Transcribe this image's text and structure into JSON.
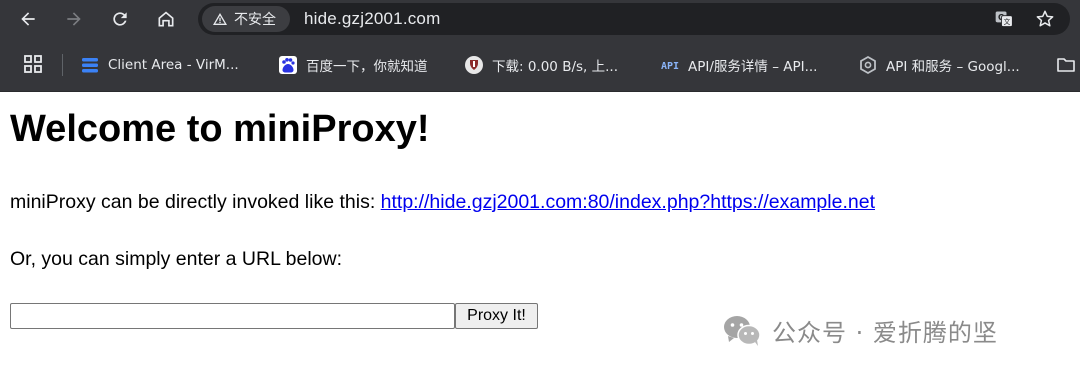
{
  "browser": {
    "security_label": "不安全",
    "url": "hide.gzj2001.com",
    "nav_icons": [
      "back-arrow-icon",
      "forward-arrow-icon",
      "reload-icon",
      "home-icon"
    ],
    "omnibox_icons": [
      "translate-icon",
      "star-icon"
    ]
  },
  "bookmarks": {
    "items": [
      {
        "label": "Client Area - VirM...",
        "icon": "stack-icon",
        "color": "#3b82f6"
      },
      {
        "label": "百度一下，你就知道",
        "icon": "paw-icon",
        "color": "#2932e1"
      },
      {
        "label": "下载: 0.00 B/s, 上...",
        "icon": "download-client-icon",
        "color": "#c9c9c9"
      },
      {
        "label": "API/服务详情 – API...",
        "icon": "api-icon",
        "color": "#8ab4f8"
      },
      {
        "label": "API 和服务 – Googl...",
        "icon": "hexagon-icon",
        "color": "#bdc1c6"
      }
    ]
  },
  "page": {
    "heading": "Welcome to miniProxy!",
    "intro_text": "miniProxy can be directly invoked like this: ",
    "example_link": "http://hide.gzj2001.com:80/index.php?https://example.net",
    "or_text": "Or, you can simply enter a URL below:",
    "input_value": "",
    "submit_label": "Proxy It!"
  },
  "watermark": {
    "text": "公众号 · 爱折腾的坚"
  },
  "colors": {
    "chrome_bg": "#35363a",
    "omnibox_bg": "#202124",
    "link": "#0000ee"
  }
}
